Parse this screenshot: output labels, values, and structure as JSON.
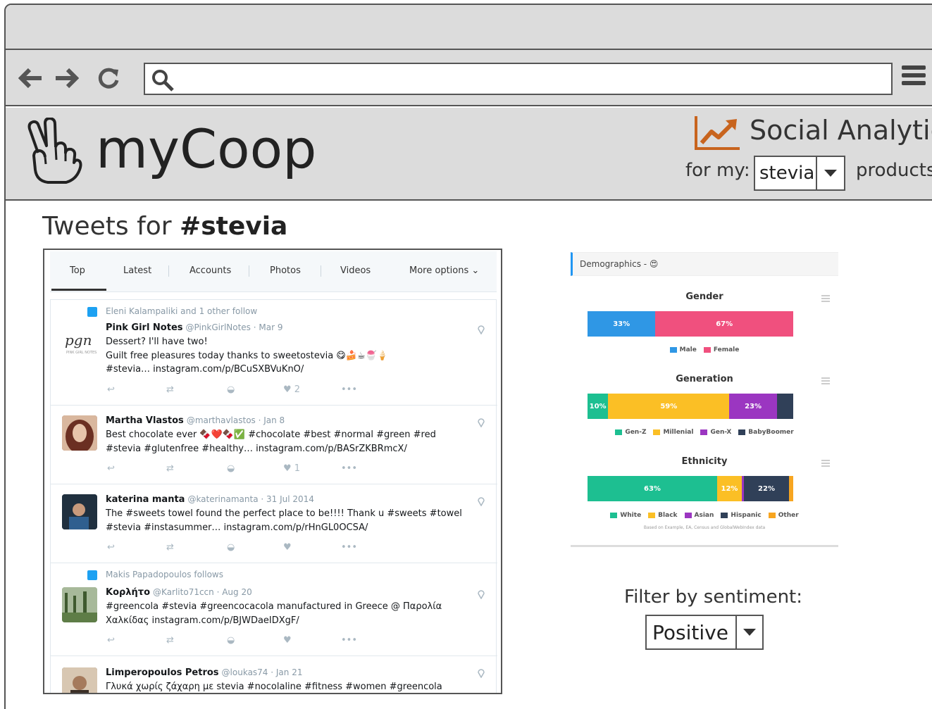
{
  "browser": {
    "url_value": "",
    "back_icon": "arrow-left-icon",
    "forward_icon": "arrow-right-icon",
    "reload_icon": "reload-icon",
    "search_icon": "search-icon",
    "menu_icon": "hamburger-menu-icon"
  },
  "app": {
    "brand": "myCoop",
    "logo_icon": "peace-hand-icon",
    "analytics_icon": "trending-chart-icon",
    "analytics_title": "Social Analytics",
    "for_my_label": "for my:",
    "product_selected": "stevia",
    "products_label": "products",
    "accent_color": "#c8641e"
  },
  "page": {
    "title_prefix": "Tweets for ",
    "title_hashtag": "#stevia"
  },
  "tweets_panel": {
    "tabs": [
      {
        "label": "Top",
        "active": true
      },
      {
        "label": "Latest"
      },
      {
        "label": "Accounts"
      },
      {
        "label": "Photos"
      },
      {
        "label": "Videos"
      },
      {
        "label": "More options"
      }
    ],
    "tweets": [
      {
        "follow_note": "Eleni Kalampaliki and 1 other follow",
        "name": "Pink Girl Notes",
        "handle": "@PinkGirlNotes · Mar 9",
        "line1": "Dessert? I'll have two!",
        "line2": "Guilt free pleasures today thanks to sweetostevia 😋🍰☕🍧🍦",
        "line3": "#stevia… instagram.com/p/BCuSXBVuKnO/",
        "likes": "2"
      },
      {
        "follow_note": "",
        "name": "Martha Vlastos",
        "handle": "@marthavlastos · Jan 8",
        "line1": "Best chocolate ever 🍫❤️🍫✅ #chocolate #best #normal #green #red",
        "line2": "#stevia #glutenfree #healthy… instagram.com/p/BASrZKBRmcX/",
        "line3": "",
        "likes": "1"
      },
      {
        "follow_note": "",
        "name": "katerina manta",
        "handle": "@katerinamanta · 31 Jul 2014",
        "line1": "The #sweets towel found the perfect place to be!!!! Thank u #sweets #towel",
        "line2": "#stevia #instasummer… instagram.com/p/rHnGL0OCSA/",
        "line3": "",
        "likes": ""
      },
      {
        "follow_note": "Makis Papadopoulos follows",
        "name": "Κορλήτο",
        "handle": "@Karlito71ccn · Aug 20",
        "line1": "#greencola #stevia #greencocacola manufactured in Greece @ Παρολία",
        "line2": "Χαλκίδας instagram.com/p/BJWDaeIDXgF/",
        "line3": "",
        "likes": ""
      },
      {
        "follow_note": "",
        "name": "Limperopoulos Petros",
        "handle": "@loukas74 · Jan 21",
        "line1": "Γλυκά χωρίς ζάχαρη με stevia #nocolaline #fitness #women #greencola",
        "line2": "",
        "line3": "",
        "likes": ""
      }
    ]
  },
  "demographics": {
    "header": "Demographics - 😍",
    "footnote": "Based on Example, EA, Census and GlobalWebIndex data"
  },
  "chart_data": [
    {
      "type": "bar",
      "stacked": true,
      "title": "Gender",
      "series": [
        {
          "name": "Male",
          "values": [
            33
          ],
          "label": "33%",
          "color": "#2f97e5"
        },
        {
          "name": "Female",
          "values": [
            67
          ],
          "label": "67%",
          "color": "#f0507e"
        }
      ]
    },
    {
      "type": "bar",
      "stacked": true,
      "title": "Generation",
      "series": [
        {
          "name": "Gen-Z",
          "values": [
            10
          ],
          "label": "10%",
          "color": "#1dbf91"
        },
        {
          "name": "Millenial",
          "values": [
            59
          ],
          "label": "59%",
          "color": "#fbbf25"
        },
        {
          "name": "Gen-X",
          "values": [
            23
          ],
          "label": "23%",
          "color": "#9b36c1"
        },
        {
          "name": "BabyBoomer",
          "values": [
            8
          ],
          "label": "",
          "color": "#304058"
        }
      ]
    },
    {
      "type": "bar",
      "stacked": true,
      "title": "Ethnicity",
      "series": [
        {
          "name": "White",
          "values": [
            63
          ],
          "label": "63%",
          "color": "#1dbf91"
        },
        {
          "name": "Black",
          "values": [
            12
          ],
          "label": "12%",
          "color": "#fbbf25"
        },
        {
          "name": "Asian",
          "values": [
            1
          ],
          "label": "",
          "color": "#9b36c1"
        },
        {
          "name": "Hispanic",
          "values": [
            22
          ],
          "label": "22%",
          "color": "#304058"
        },
        {
          "name": "Other",
          "values": [
            2
          ],
          "label": "",
          "color": "#f7a520"
        }
      ]
    }
  ],
  "filter": {
    "label": "Filter by sentiment:",
    "selected": "Positive"
  }
}
